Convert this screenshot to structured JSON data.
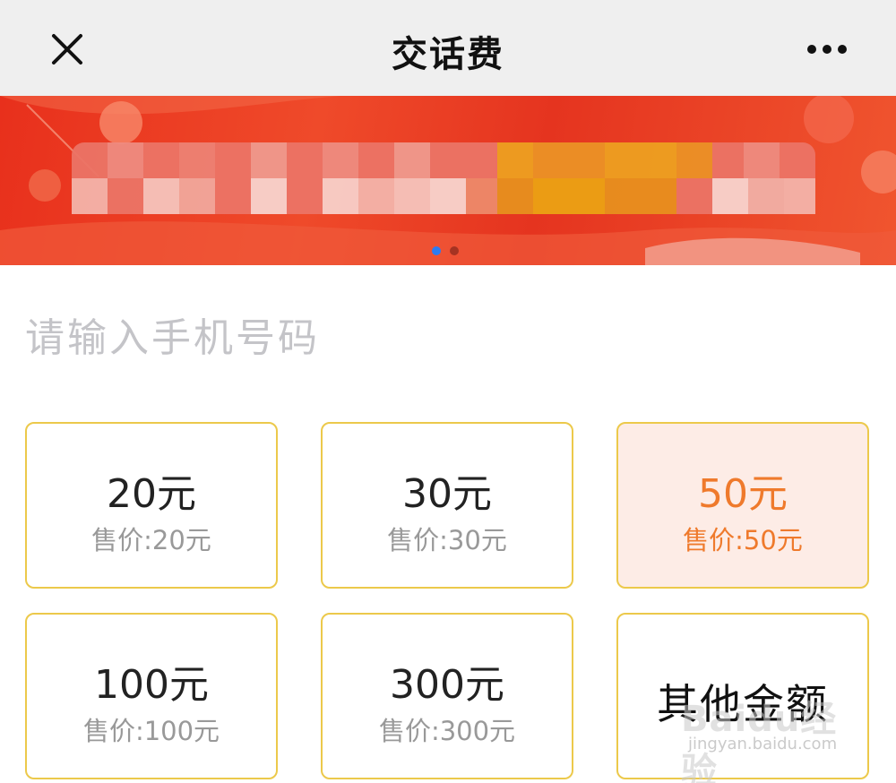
{
  "header": {
    "title": "交话费"
  },
  "banner": {
    "slides": 2,
    "active_index": 0,
    "colors": {
      "primary": "#e8301c",
      "accent": "#f0a020",
      "dot_active": "#2e7bf0"
    }
  },
  "phone": {
    "placeholder": "请输入手机号码",
    "value": ""
  },
  "amounts": [
    {
      "amount": "20元",
      "price": "售价:20元",
      "selected": false
    },
    {
      "amount": "30元",
      "price": "售价:30元",
      "selected": false
    },
    {
      "amount": "50元",
      "price": "售价:50元",
      "selected": true
    },
    {
      "amount": "100元",
      "price": "售价:100元",
      "selected": false
    },
    {
      "amount": "300元",
      "price": "售价:300元",
      "selected": false
    },
    {
      "amount": "其他金额",
      "price": "",
      "selected": false
    }
  ],
  "watermark": {
    "logo": "Baidu经验",
    "url": "jingyan.baidu.com"
  },
  "icons": [
    "close-icon",
    "more-icon"
  ]
}
